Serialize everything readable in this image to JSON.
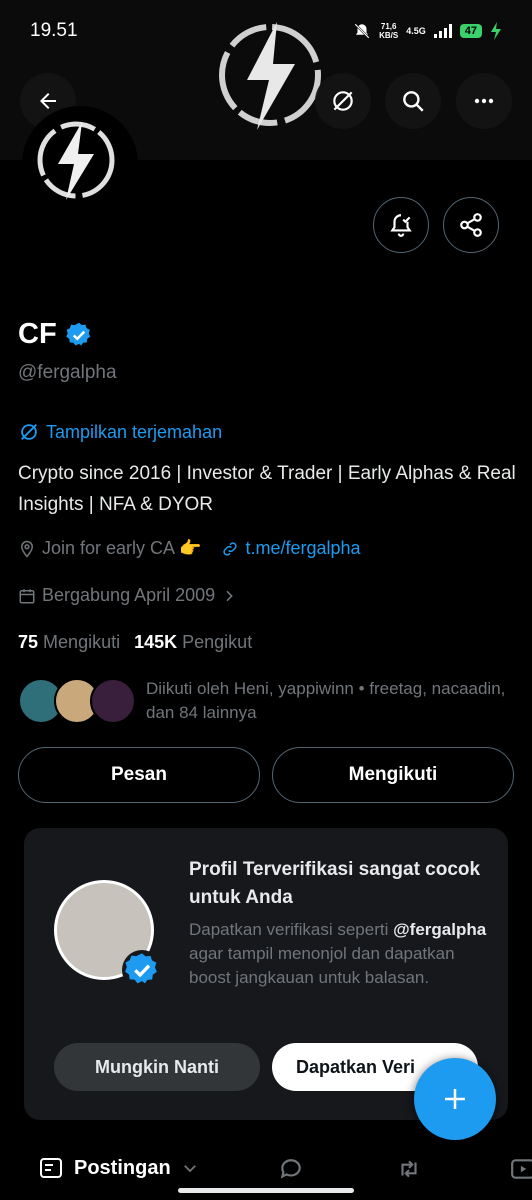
{
  "status": {
    "time": "19.51",
    "speed_value": "71,6",
    "speed_unit": "KB/S",
    "network": "4.5G",
    "battery": "47"
  },
  "profile": {
    "name": "CF",
    "handle": "@fergalpha",
    "translate_label": "Tampilkan terjemahan",
    "bio": "Crypto since 2016 | Investor & Trader | Early Alphas & Real Insights | NFA & DYOR",
    "location": "Join for early CA 👉",
    "website": "t.me/fergalpha",
    "joined": "Bergabung April 2009",
    "following_count": "75",
    "following_label": "Mengikuti",
    "followers_count": "145K",
    "followers_label": "Pengikut",
    "followed_by": "Diikuti oleh Heni, yappiwinn • freetag, nacaadin, dan 84 lainnya"
  },
  "actions": {
    "message": "Pesan",
    "following": "Mengikuti"
  },
  "verify_card": {
    "title": "Profil Terverifikasi sangat cocok untuk Anda",
    "desc_prefix": "Dapatkan verifikasi seperti",
    "desc_handle": "@fergalpha",
    "desc_suffix": "agar tampil menonjol dan dapatkan boost jangkauan untuk balasan.",
    "later_button": "Mungkin Nanti",
    "verify_button": "Dapatkan Veri"
  },
  "tabs": {
    "posts": "Postingan"
  },
  "colors": {
    "accent": "#1d9bf0",
    "background": "#000000",
    "card": "#16181c",
    "muted": "#71767b"
  }
}
